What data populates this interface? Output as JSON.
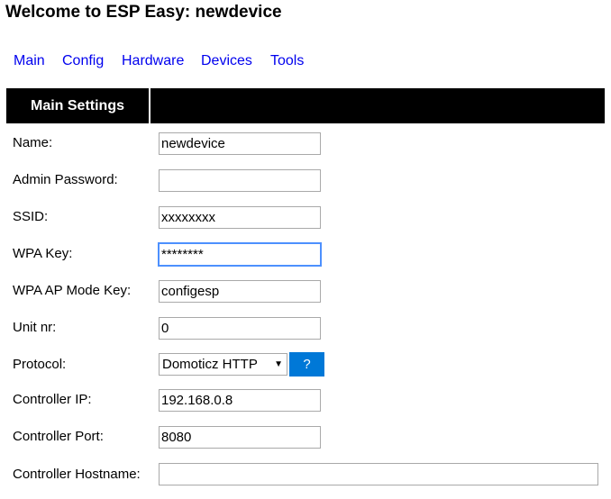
{
  "page": {
    "title": "Welcome to ESP Easy: newdevice"
  },
  "nav": {
    "items": [
      "Main",
      "Config",
      "Hardware",
      "Devices",
      "Tools"
    ]
  },
  "section": {
    "header": "Main Settings"
  },
  "fields": {
    "name": {
      "label": "Name:",
      "value": "newdevice"
    },
    "admin_password": {
      "label": "Admin Password:",
      "value": ""
    },
    "ssid": {
      "label": "SSID:",
      "value": "xxxxxxxx"
    },
    "wpa_key": {
      "label": "WPA Key:",
      "value": "********"
    },
    "wpa_ap_mode_key": {
      "label": "WPA AP Mode Key:",
      "value": "configesp"
    },
    "unit_nr": {
      "label": "Unit nr:",
      "value": "0"
    },
    "protocol": {
      "label": "Protocol:",
      "value": "Domoticz HTTP",
      "help_label": "?"
    },
    "controller_ip": {
      "label": "Controller IP:",
      "value": "192.168.0.8"
    },
    "controller_port": {
      "label": "Controller Port:",
      "value": "8080"
    },
    "controller_hostname": {
      "label": "Controller Hostname:",
      "value": ""
    }
  },
  "colors": {
    "link": "#0000ee",
    "header_bg": "#000000",
    "help_button": "#0078d7",
    "focus": "#4d90fe"
  }
}
